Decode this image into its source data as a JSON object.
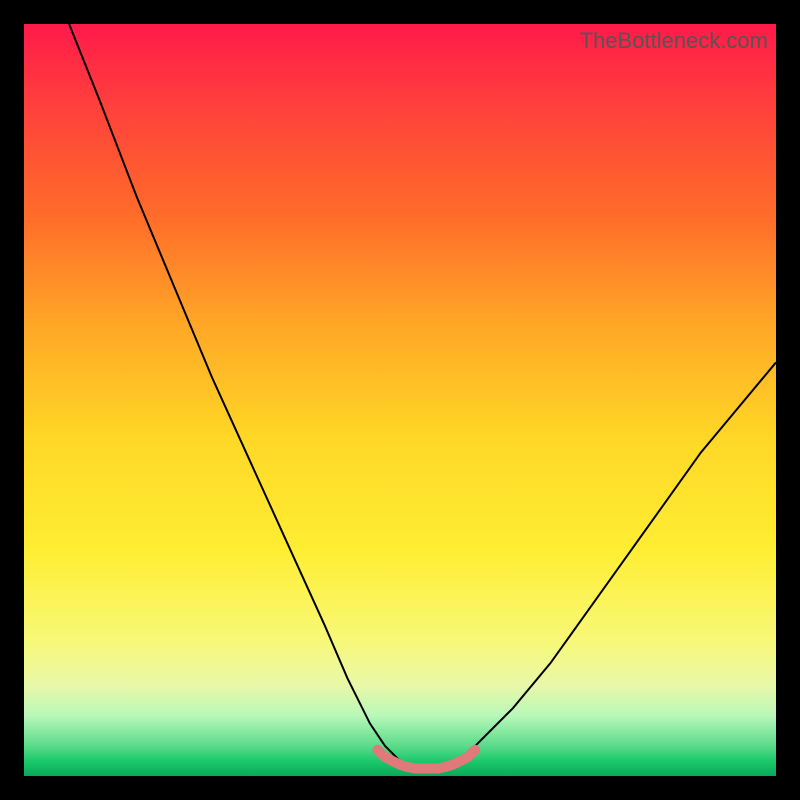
{
  "watermark": "TheBottleneck.com",
  "chart_data": {
    "type": "line",
    "title": "",
    "xlabel": "",
    "ylabel": "",
    "xlim": [
      0,
      100
    ],
    "ylim": [
      0,
      100
    ],
    "series": [
      {
        "name": "curve",
        "x": [
          6,
          10,
          15,
          20,
          25,
          30,
          35,
          40,
          43,
          46,
          48,
          50,
          52,
          54,
          56,
          58,
          60,
          65,
          70,
          75,
          80,
          85,
          90,
          95,
          100
        ],
        "y": [
          100,
          90,
          77,
          65,
          53,
          42,
          31,
          20,
          13,
          7,
          4,
          2,
          1,
          1,
          1,
          2,
          4,
          9,
          15,
          22,
          29,
          36,
          43,
          49,
          55
        ]
      },
      {
        "name": "highlight",
        "x": [
          47,
          48,
          49,
          50,
          51,
          52,
          53,
          54,
          55,
          56,
          57,
          58,
          59,
          60
        ],
        "y": [
          3.5,
          2.5,
          2,
          1.5,
          1.2,
          1,
          1,
          1,
          1,
          1.2,
          1.5,
          2,
          2.5,
          3.5
        ]
      }
    ],
    "colors": {
      "curve": "#000000",
      "highlight": "#e07a7a",
      "gradient_top": "#ff1a4a",
      "gradient_bottom": "#0aa85a"
    }
  }
}
